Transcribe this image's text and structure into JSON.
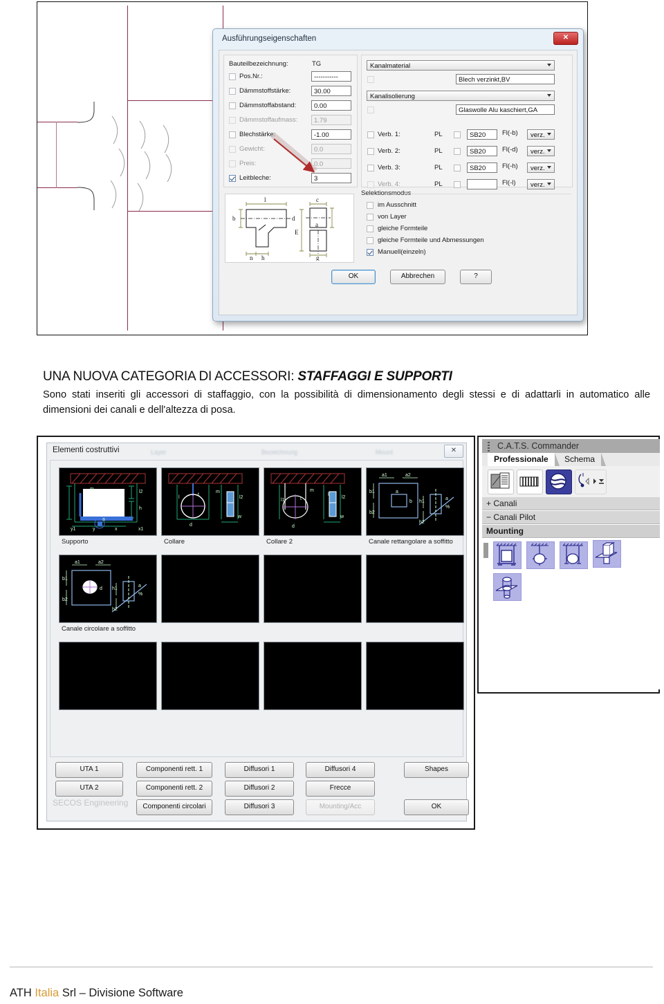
{
  "document": {
    "headline_plain": "UNA NUOVA CATEGORIA DI ACCESSORI: ",
    "headline_emphasis": "STAFFAGGI E SUPPORTI",
    "paragraph": "Sono stati inseriti gli accessori di staffaggio, con la possibilità di dimensionamento degli stessi e di adattarli in automatico alle dimensioni dei canali e dell'altezza di posa.",
    "footer": {
      "company": "ATH ",
      "brand": "Italia",
      "rest": " Srl – Divisione Software",
      "brand_color": "#d79b36"
    }
  },
  "de_dialog": {
    "title": "Ausführungseigenschaften",
    "close_label": "✕",
    "left_panel": {
      "component_label": "Bauteilbezeichnung:",
      "component_value": "TG",
      "rows": [
        {
          "label": "Pos.Nr.:",
          "value": "-----------",
          "checked": false,
          "disabled": false
        },
        {
          "label": "Dämmstoffstärke:",
          "value": "30.00",
          "checked": false,
          "disabled": false
        },
        {
          "label": "Dämmstoffabstand:",
          "value": "0.00",
          "checked": false,
          "disabled": false
        },
        {
          "label": "Dämmstoffaufmass:",
          "value": "1.79",
          "checked": false,
          "disabled": true
        },
        {
          "label": "Blechstärke:",
          "value": "-1.00",
          "checked": false,
          "disabled": false
        },
        {
          "label": "Gewicht:",
          "value": "0.0",
          "checked": false,
          "disabled": true
        },
        {
          "label": "Preis:",
          "value": "0.0",
          "checked": false,
          "disabled": true
        },
        {
          "label": "Leitbleche:",
          "value": "3",
          "checked": true,
          "disabled": false
        }
      ]
    },
    "right_panel": {
      "material_combo": "Kanalmaterial",
      "material_value": "Blech verzinkt,BV",
      "insulation_combo": "Kanalisolierung",
      "insulation_value": "Glaswolle Alu kaschiert,GA",
      "connection_rows": [
        {
          "label": "Verb. 1:",
          "pl": "PL",
          "value": "SB20",
          "flag": "Fl(-b)",
          "combo": "verz.",
          "disabled": false
        },
        {
          "label": "Verb. 2:",
          "pl": "PL",
          "value": "SB20",
          "flag": "Fl(-d)",
          "combo": "verz.",
          "disabled": false
        },
        {
          "label": "Verb. 3:",
          "pl": "PL",
          "value": "SB20",
          "flag": "Fl(-h)",
          "combo": "verz.",
          "disabled": false
        },
        {
          "label": "Verb. 4:",
          "pl": "PL",
          "value": "",
          "flag": "Fl(-l)",
          "combo": "verz.",
          "disabled": true
        }
      ]
    },
    "selection_mode": {
      "title": "Selektionsmodus",
      "options": [
        {
          "label": "im Ausschnitt",
          "checked": false
        },
        {
          "label": "von Layer",
          "checked": false
        },
        {
          "label": "gleiche Formteile",
          "checked": false
        },
        {
          "label": "gleiche Formteile und Abmessungen",
          "checked": false
        },
        {
          "label": "Manuell(einzeln)",
          "checked": true
        }
      ]
    },
    "buttons": {
      "ok": "OK",
      "cancel": "Abbrechen",
      "help": "?"
    },
    "sketch_labels": [
      "l",
      "c",
      "b",
      "d",
      "E",
      "n",
      "h",
      "g",
      "a"
    ]
  },
  "elementi_dialog": {
    "title": "Elementi costruttivi",
    "close_label": "✕",
    "faded_menus": [
      "Layer",
      "Bezeichnung",
      "Mount"
    ],
    "thumbnails": [
      {
        "caption": "Supporto",
        "has_image": true
      },
      {
        "caption": "Collare",
        "has_image": true
      },
      {
        "caption": "Collare 2",
        "has_image": true
      },
      {
        "caption": "Canale rettangolare a soffitto",
        "has_image": true
      },
      {
        "caption": "Canale circolare a soffitto",
        "has_image": true
      },
      {
        "caption": "",
        "has_image": false
      },
      {
        "caption": "",
        "has_image": false
      },
      {
        "caption": "",
        "has_image": false
      },
      {
        "caption": "",
        "has_image": false
      },
      {
        "caption": "",
        "has_image": false
      },
      {
        "caption": "",
        "has_image": false
      },
      {
        "caption": "",
        "has_image": false
      }
    ],
    "watermark": "SECOS Engineering",
    "buttons": [
      {
        "label": "UTA 1",
        "disabled": false
      },
      {
        "label": "UTA 2",
        "disabled": false
      },
      {
        "label": "Componenti rett. 1",
        "disabled": false
      },
      {
        "label": "Componenti rett. 2",
        "disabled": false
      },
      {
        "label": "Componenti circolari",
        "disabled": false
      },
      {
        "label": "Diffusori 1",
        "disabled": false
      },
      {
        "label": "Diffusori 2",
        "disabled": false
      },
      {
        "label": "Diffusori 3",
        "disabled": false
      },
      {
        "label": "Diffusori 4",
        "disabled": false
      },
      {
        "label": "Frecce",
        "disabled": false
      },
      {
        "label": "Mounting/Acc",
        "disabled": true
      },
      {
        "label": "Shapes",
        "disabled": false
      },
      {
        "label": "OK",
        "disabled": false
      }
    ]
  },
  "cats_panel": {
    "title": "C.A.T.S. Commander",
    "tabs": [
      {
        "label": "Professionale",
        "active": true
      },
      {
        "label": "Schema",
        "active": false
      }
    ],
    "toolbar_icons": [
      "building-icon",
      "radiator-icon",
      "duct-fan-icon",
      "node-tools-icon"
    ],
    "sections": [
      {
        "sign": "+",
        "label": "Canali"
      },
      {
        "sign": "−",
        "label": "Canali Pilot"
      }
    ],
    "group_title": "Mounting",
    "mounting_icons": [
      "rect-duct-hanger-icon",
      "round-duct-single-hanger-icon",
      "round-duct-double-hanger-icon",
      "rect-duct-through-slab-icon",
      "round-duct-through-slab-icon"
    ]
  }
}
